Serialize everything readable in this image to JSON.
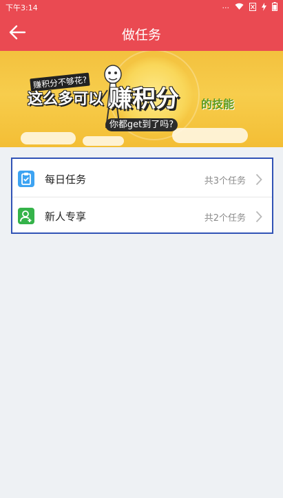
{
  "status_bar": {
    "time": "下午3:14",
    "icons": [
      "dots-icon",
      "wifi-icon",
      "sim-icon",
      "charging-icon",
      "battery-icon"
    ]
  },
  "header": {
    "title": "做任务",
    "back_icon": "back-arrow-icon"
  },
  "banner": {
    "line1": "赚积分不够花?",
    "line2": "这么多可以",
    "line2_big": "赚积分",
    "line2_tail": "的技能",
    "line3": "你都get到了吗?"
  },
  "tasks": [
    {
      "label": "每日任务",
      "count": "共3个任务",
      "icon": "clipboard-icon",
      "icon_color": "#3da3f2"
    },
    {
      "label": "新人专享",
      "count": "共2个任务",
      "icon": "user-add-icon",
      "icon_color": "#35b34a"
    }
  ],
  "colors": {
    "header_bg": "#ea4a52",
    "page_bg": "#eef1f4",
    "highlight_border": "#2f52b5"
  }
}
